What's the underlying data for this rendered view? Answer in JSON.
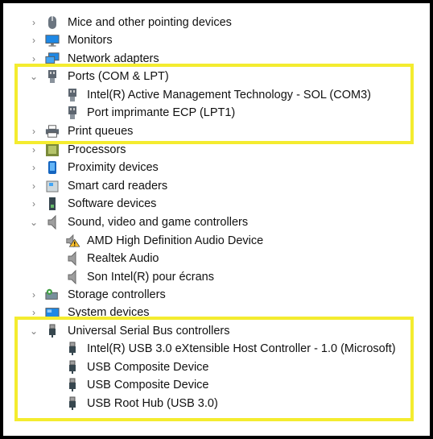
{
  "device_tree": {
    "items": [
      {
        "label": "Mice and other pointing devices",
        "icon": "mouse-icon",
        "state": "collapsed",
        "level": 0
      },
      {
        "label": "Monitors",
        "icon": "monitor-icon",
        "state": "collapsed",
        "level": 0
      },
      {
        "label": "Network adapters",
        "icon": "network-adapter-icon",
        "state": "collapsed",
        "level": 0
      },
      {
        "label": "Ports (COM & LPT)",
        "icon": "port-icon",
        "state": "expanded",
        "level": 0
      },
      {
        "label": "Intel(R) Active Management Technology - SOL (COM3)",
        "icon": "port-icon",
        "state": "leaf",
        "level": 1
      },
      {
        "label": "Port imprimante ECP (LPT1)",
        "icon": "port-icon",
        "state": "leaf",
        "level": 1
      },
      {
        "label": "Print queues",
        "icon": "printer-icon",
        "state": "collapsed",
        "level": 0
      },
      {
        "label": "Processors",
        "icon": "processor-icon",
        "state": "collapsed",
        "level": 0
      },
      {
        "label": "Proximity devices",
        "icon": "proximity-device-icon",
        "state": "collapsed",
        "level": 0
      },
      {
        "label": "Smart card readers",
        "icon": "smart-card-reader-icon",
        "state": "collapsed",
        "level": 0
      },
      {
        "label": "Software devices",
        "icon": "software-device-icon",
        "state": "collapsed",
        "level": 0
      },
      {
        "label": "Sound, video and game controllers",
        "icon": "speaker-icon",
        "state": "expanded",
        "level": 0
      },
      {
        "label": "AMD High Definition Audio Device",
        "icon": "speaker-warning-icon",
        "state": "leaf",
        "level": 1
      },
      {
        "label": "Realtek Audio",
        "icon": "speaker-icon",
        "state": "leaf",
        "level": 1
      },
      {
        "label": "Son Intel(R) pour écrans",
        "icon": "speaker-icon",
        "state": "leaf",
        "level": 1
      },
      {
        "label": "Storage controllers",
        "icon": "storage-controller-icon",
        "state": "collapsed",
        "level": 0
      },
      {
        "label": "System devices",
        "icon": "system-device-icon",
        "state": "collapsed",
        "level": 0
      },
      {
        "label": "Universal Serial Bus controllers",
        "icon": "usb-icon",
        "state": "expanded",
        "level": 0
      },
      {
        "label": "Intel(R) USB 3.0 eXtensible Host Controller - 1.0 (Microsoft)",
        "icon": "usb-icon",
        "state": "leaf",
        "level": 1
      },
      {
        "label": "USB Composite Device",
        "icon": "usb-icon",
        "state": "leaf",
        "level": 1
      },
      {
        "label": "USB Composite Device",
        "icon": "usb-icon",
        "state": "leaf",
        "level": 1
      },
      {
        "label": "USB Root Hub (USB 3.0)",
        "icon": "usb-icon",
        "state": "leaf",
        "level": 1
      }
    ]
  },
  "highlight_color": "#f4ec2f",
  "border_color": "#000000"
}
